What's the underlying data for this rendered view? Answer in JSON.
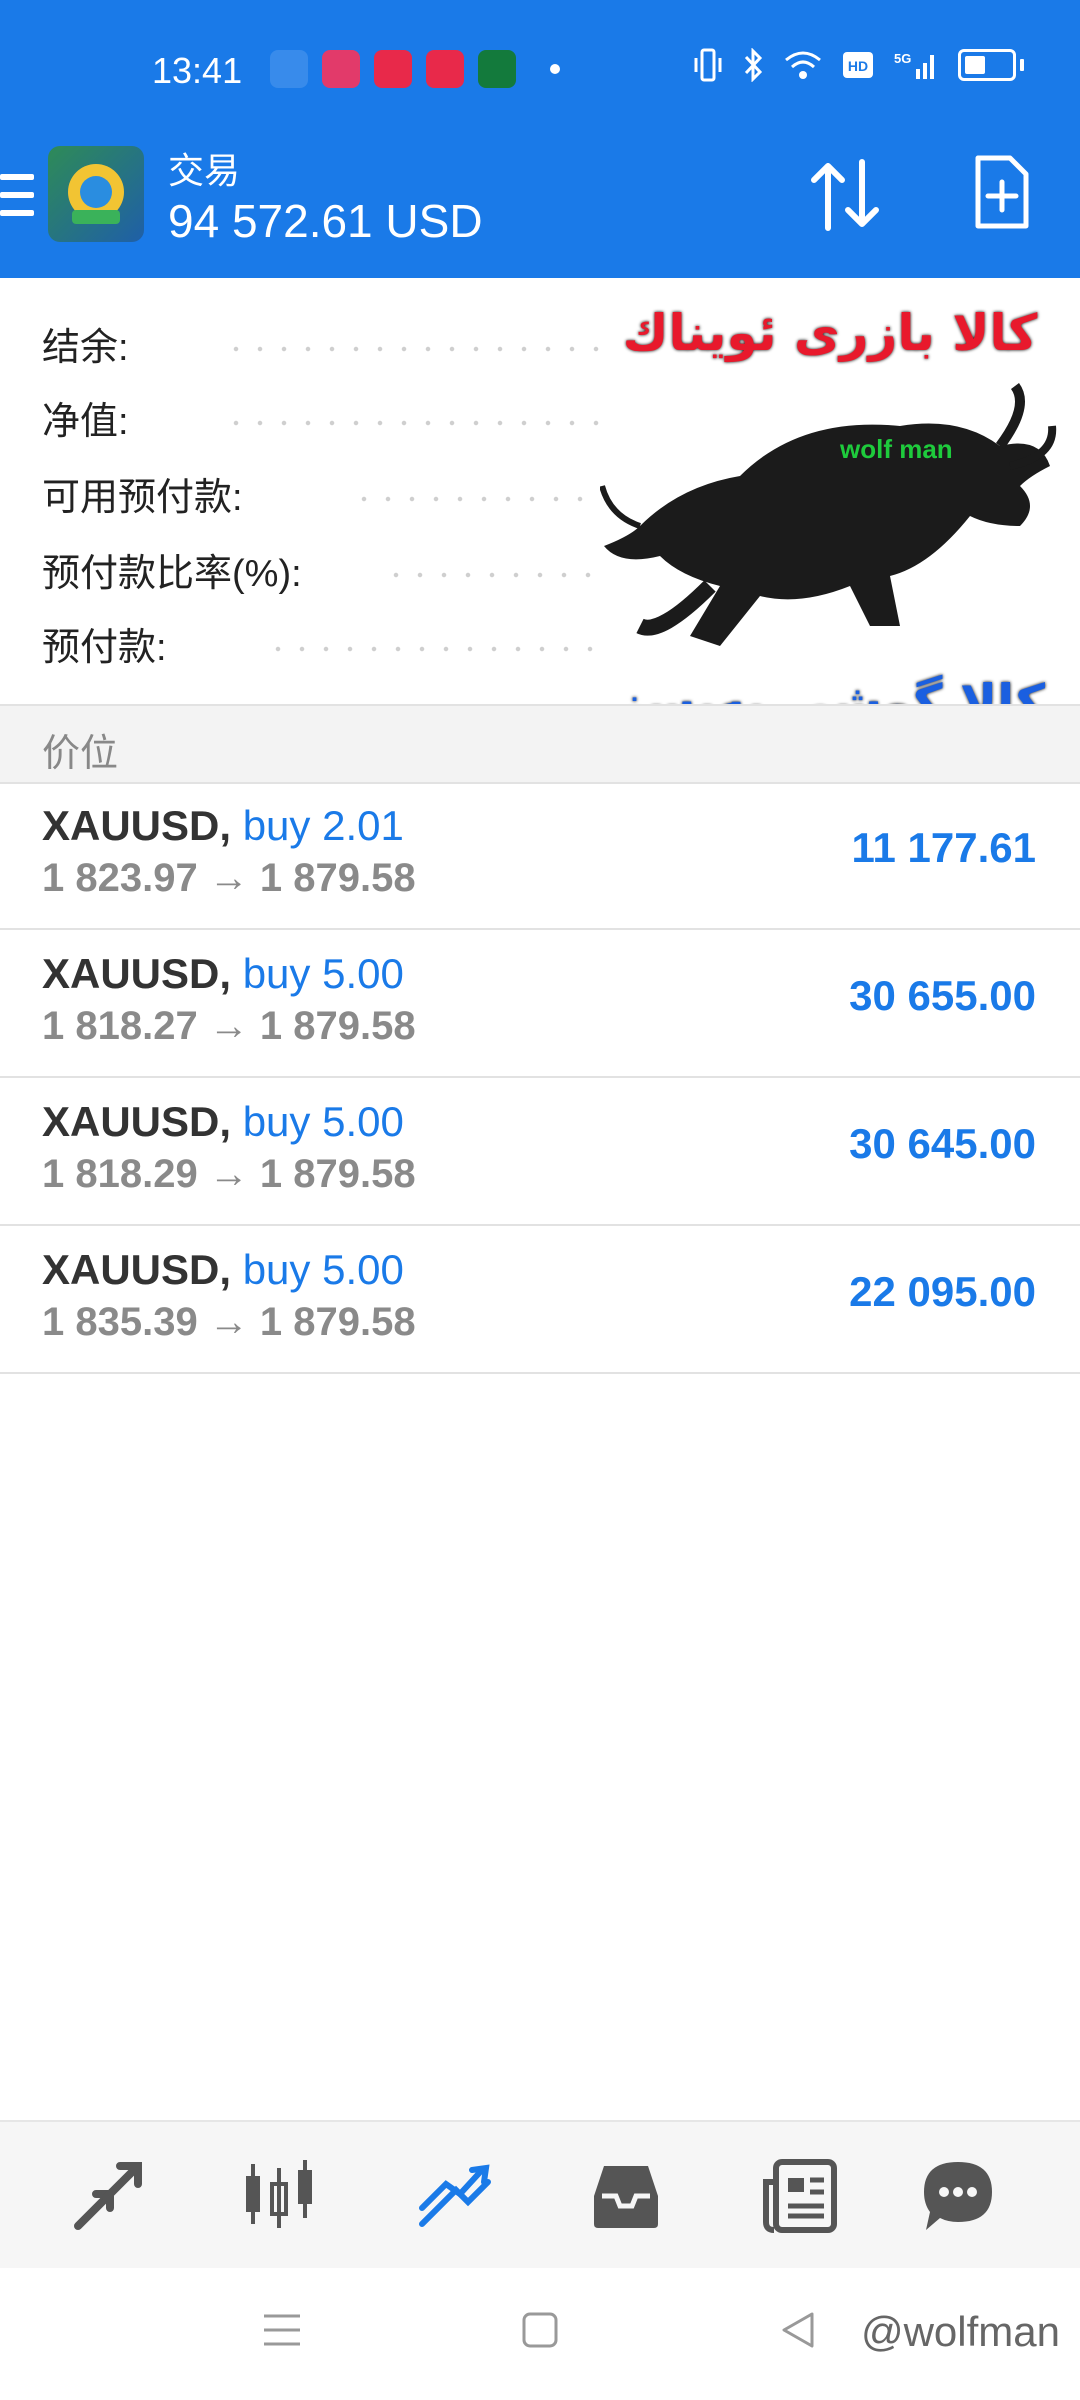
{
  "status_bar": {
    "time": "13:41",
    "battery_icon": "battery-icon"
  },
  "app_bar": {
    "title": "交易",
    "balance": "94 572.61 USD"
  },
  "summary": {
    "rows": [
      {
        "label": "结余:"
      },
      {
        "label": "净值:"
      },
      {
        "label": "可用预付款:"
      },
      {
        "label": "预付款比率(%):"
      },
      {
        "label": "预付款:"
      }
    ]
  },
  "promo": {
    "top_text": "کالا بازری ئویناك",
    "brand": "wolf man",
    "bottom_text": "کالا گوشی یەیسز"
  },
  "section": {
    "header": "价位"
  },
  "positions": [
    {
      "symbol": "XAUUSD,",
      "side": "buy 2.01",
      "prices": "1 823.97 → 1 879.58",
      "profit": "11 177.61"
    },
    {
      "symbol": "XAUUSD,",
      "side": "buy 5.00",
      "prices": "1 818.27 → 1 879.58",
      "profit": "30 655.00"
    },
    {
      "symbol": "XAUUSD,",
      "side": "buy 5.00",
      "prices": "1 818.29 → 1 879.58",
      "profit": "30 645.00"
    },
    {
      "symbol": "XAUUSD,",
      "side": "buy 5.00",
      "prices": "1 835.39 → 1 879.58",
      "profit": "22 095.00"
    }
  ],
  "toolbar": {
    "items": [
      "quotes-icon",
      "chart-icon",
      "trade-icon",
      "history-icon",
      "news-icon",
      "messages-icon"
    ],
    "active_color": "#1a7ae8"
  },
  "nav": {
    "watermark": "@wolfman"
  },
  "colors": {
    "accent": "#1a7ae8"
  }
}
